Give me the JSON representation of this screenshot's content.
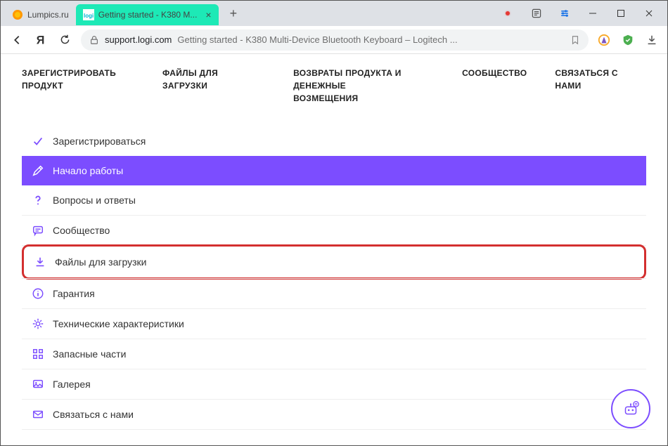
{
  "browser": {
    "tabs": [
      {
        "title": "Lumpics.ru",
        "active": false
      },
      {
        "title": "Getting started - K380 M...",
        "active": true
      }
    ],
    "url_domain": "support.logi.com",
    "url_path": "Getting started - K380 Multi-Device Bluetooth Keyboard – Logitech ..."
  },
  "topnav": {
    "register_product": "ЗАРЕГИСТРИРОВАТЬ ПРОДУКТ",
    "downloads": "ФАЙЛЫ ДЛЯ ЗАГРУЗКИ",
    "returns": "ВОЗВРАТЫ ПРОДУКТА И ДЕНЕЖНЫЕ ВОЗМЕЩЕНИЯ",
    "community": "СООБЩЕСТВО",
    "contact": "СВЯЗАТЬСЯ С НАМИ"
  },
  "sidebar": {
    "items": [
      {
        "label": "Зарегистрироваться",
        "icon": "check-icon"
      },
      {
        "label": "Начало работы",
        "icon": "pencil-icon"
      },
      {
        "label": "Вопросы и ответы",
        "icon": "question-icon"
      },
      {
        "label": "Сообщество",
        "icon": "chat-icon"
      },
      {
        "label": "Файлы для загрузки",
        "icon": "download-icon"
      },
      {
        "label": "Гарантия",
        "icon": "info-circle-icon"
      },
      {
        "label": "Технические характеристики",
        "icon": "gear-icon"
      },
      {
        "label": "Запасные части",
        "icon": "grid-icon"
      },
      {
        "label": "Галерея",
        "icon": "gallery-icon"
      },
      {
        "label": "Связаться с нами",
        "icon": "mail-icon"
      }
    ]
  }
}
